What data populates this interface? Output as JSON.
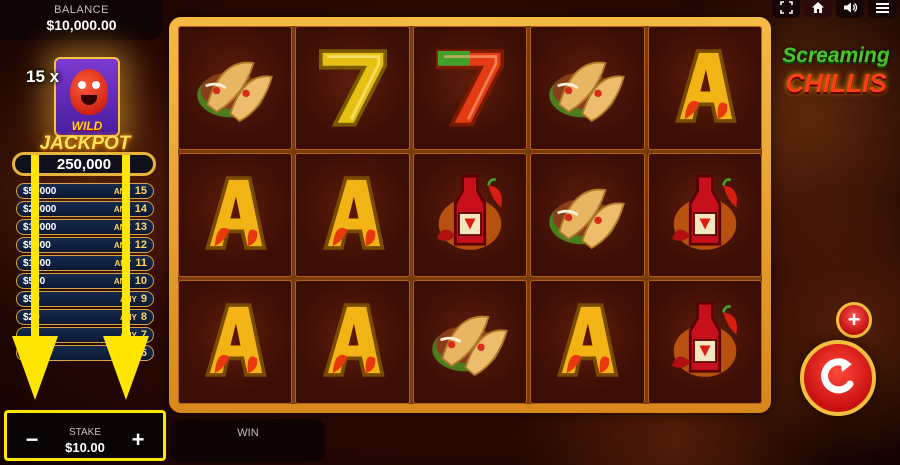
{
  "balance": {
    "label": "BALANCE",
    "value": "$10,000.00"
  },
  "top_controls": [
    {
      "name": "fullscreen-icon",
      "glyph": "⛶"
    },
    {
      "name": "home-icon",
      "glyph": "⌂"
    },
    {
      "name": "sound-icon",
      "glyph": "🔊"
    },
    {
      "name": "menu-icon",
      "glyph": "≡"
    }
  ],
  "jackpot": {
    "multiplier": "15 x",
    "wild_label": "WILD",
    "title": "JACKPOT",
    "value": "250,000",
    "prizes": [
      {
        "amount": "$50000",
        "any_label": "ANY",
        "count": "15"
      },
      {
        "amount": "$20000",
        "any_label": "ANY",
        "count": "14"
      },
      {
        "amount": "$10000",
        "any_label": "ANY",
        "count": "13"
      },
      {
        "amount": "$5000",
        "any_label": "ANY",
        "count": "12"
      },
      {
        "amount": "$1000",
        "any_label": "ANY",
        "count": "11"
      },
      {
        "amount": "$500",
        "any_label": "ANY",
        "count": "10"
      },
      {
        "amount": "$50",
        "any_label": "ANY",
        "count": "9"
      },
      {
        "amount": "$20",
        "any_label": "ANY",
        "count": "8"
      },
      {
        "amount": "",
        "any_label": "ANY",
        "count": "7"
      },
      {
        "amount": "",
        "any_label": "ANY",
        "count": "6"
      }
    ]
  },
  "reels": [
    [
      "taco",
      "seven-yellow",
      "seven-red",
      "taco",
      "ace"
    ],
    [
      "ace",
      "ace",
      "hot-sauce",
      "taco",
      "hot-sauce"
    ],
    [
      "ace",
      "ace",
      "taco",
      "ace",
      "hot-sauce"
    ]
  ],
  "logo": {
    "line1": "Screaming",
    "line2": "CHILLIS"
  },
  "stake": {
    "label": "STAKE",
    "value": "$10.00",
    "minus": "−",
    "plus": "+"
  },
  "win": {
    "label": "WIN"
  },
  "colors": {
    "frame_gold": "#f3bf3c",
    "spin_red": "#c81010",
    "annotation_yellow": "#ffe600"
  }
}
